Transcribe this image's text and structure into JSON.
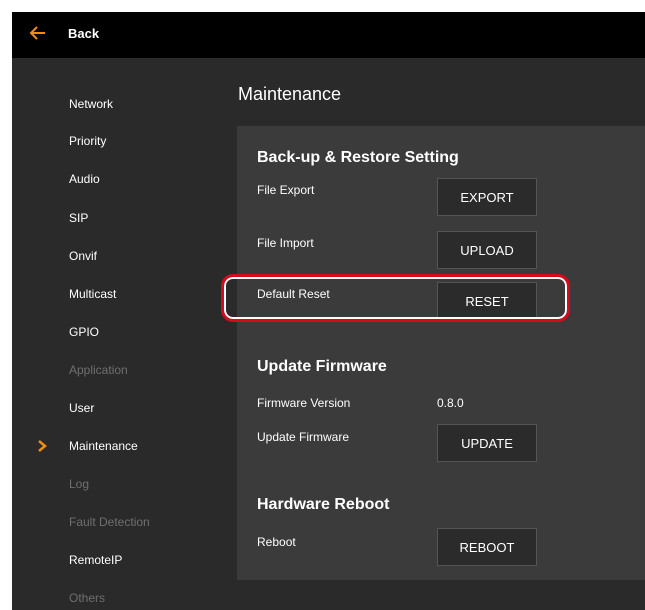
{
  "header": {
    "back_label": "Back",
    "back_icon": "arrow-left-icon"
  },
  "sidebar": {
    "items": [
      {
        "label": "Network",
        "disabled": false
      },
      {
        "label": "Priority",
        "disabled": false
      },
      {
        "label": "Audio",
        "disabled": false
      },
      {
        "label": "SIP",
        "disabled": false
      },
      {
        "label": "Onvif",
        "disabled": false
      },
      {
        "label": "Multicast",
        "disabled": false
      },
      {
        "label": "GPIO",
        "disabled": false
      },
      {
        "label": "Application",
        "disabled": true
      },
      {
        "label": "User",
        "disabled": false
      },
      {
        "label": "Maintenance",
        "disabled": false,
        "active": true
      },
      {
        "label": "Log",
        "disabled": true
      },
      {
        "label": "Fault Detection",
        "disabled": true
      },
      {
        "label": "RemoteIP",
        "disabled": false
      },
      {
        "label": "Others",
        "disabled": true
      }
    ]
  },
  "main": {
    "title": "Maintenance",
    "backup": {
      "title": "Back-up & Restore Setting",
      "file_export_label": "File Export",
      "export_button": "EXPORT",
      "file_import_label": "File Import",
      "upload_button": "UPLOAD",
      "default_reset_label": "Default Reset",
      "reset_button": "RESET"
    },
    "firmware": {
      "title": "Update Firmware",
      "version_label": "Firmware Version",
      "version_value": "0.8.0",
      "update_label": "Update Firmware",
      "update_button": "UPDATE"
    },
    "reboot": {
      "title": "Hardware Reboot",
      "reboot_label": "Reboot",
      "reboot_button": "REBOOT"
    }
  },
  "colors": {
    "accent": "#f28c12",
    "highlight": "#d8091c",
    "background": "#2a2a2a",
    "panel": "#3b3b3b",
    "topbar": "#000000",
    "disabled_text": "#6f6f6f"
  }
}
